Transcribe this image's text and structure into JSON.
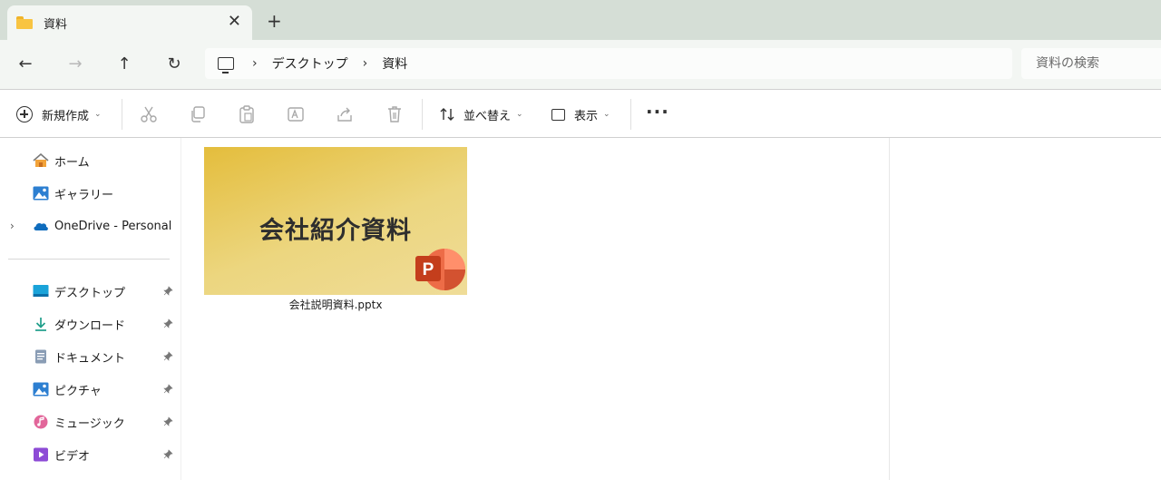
{
  "window": {
    "tab_title": "資料",
    "close_label": "✕",
    "newtab_label": "+"
  },
  "nav": {
    "back": "←",
    "forward": "→",
    "up": "↑",
    "refresh": "↻"
  },
  "address": {
    "sep": "›",
    "crumbs": [
      "デスクトップ",
      "資料"
    ]
  },
  "search": {
    "placeholder": "資料の検索"
  },
  "commands": {
    "new_label": "新規作成",
    "sort_label": "並べ替え",
    "view_label": "表示",
    "chevron": "⌄",
    "more_label": "···"
  },
  "sidebar": {
    "items": [
      {
        "label": "ホーム",
        "icon": "home-icon"
      },
      {
        "label": "ギャラリー",
        "icon": "gallery-icon"
      },
      {
        "label": "OneDrive - Personal",
        "icon": "onedrive-icon",
        "expander": "›"
      }
    ],
    "pinned": [
      {
        "label": "デスクトップ",
        "icon": "desktop-icon"
      },
      {
        "label": "ダウンロード",
        "icon": "download-icon"
      },
      {
        "label": "ドキュメント",
        "icon": "documents-icon"
      },
      {
        "label": "ピクチャ",
        "icon": "pictures-icon"
      },
      {
        "label": "ミュージック",
        "icon": "music-icon"
      },
      {
        "label": "ビデオ",
        "icon": "videos-icon"
      }
    ],
    "pin_glyph": "📌"
  },
  "files": [
    {
      "name": "会社説明資料.pptx",
      "thumb_title": "会社紹介資料",
      "badge_letter": "P"
    }
  ],
  "colors": {
    "tabbar": "#d5ded6",
    "toolbar": "#f3f6f3",
    "ppt_orange": "#d35230",
    "folder_yellow": "#f8c442"
  }
}
